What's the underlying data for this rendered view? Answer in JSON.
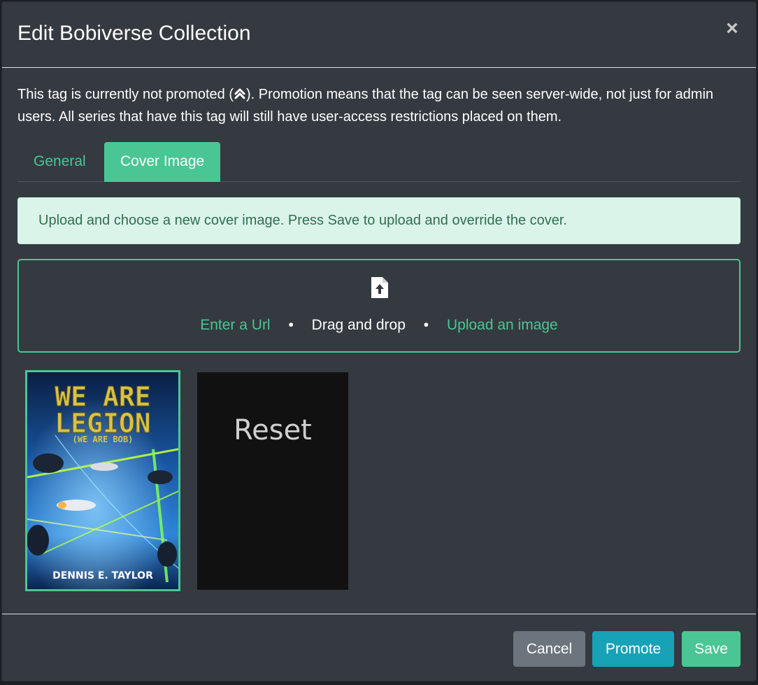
{
  "modal": {
    "title": "Edit Bobiverse Collection",
    "close_label": "×"
  },
  "intro": {
    "text_before": "This tag is currently not promoted (",
    "promo_glyph": "⏫",
    "text_after": "). Promotion means that the tag can be seen server-wide, not just for admin users. All series that have this tag will still have user-access restrictions placed on them."
  },
  "tabs": [
    {
      "label": "General",
      "active": false
    },
    {
      "label": "Cover Image",
      "active": true
    }
  ],
  "alert": {
    "text": "Upload and choose a new cover image. Press Save to upload and override the cover."
  },
  "dropzone": {
    "icon": "file-upload-icon",
    "enter_url": "Enter a Url",
    "separator": "•",
    "drag_drop": "Drag and drop",
    "upload_image": "Upload an image"
  },
  "cover": {
    "title_line1": "WE ARE",
    "title_line2": "LEGION",
    "subtitle": "(WE ARE BOB)",
    "author": "DENNIS E. TAYLOR",
    "selected": true
  },
  "reset_tile": {
    "label": "Reset"
  },
  "footer": {
    "cancel": "Cancel",
    "promote": "Promote",
    "save": "Save"
  },
  "colors": {
    "accent": "#4ac694",
    "info": "#17a2b8",
    "secondary": "#6c757d",
    "modal_bg": "#343a40"
  }
}
